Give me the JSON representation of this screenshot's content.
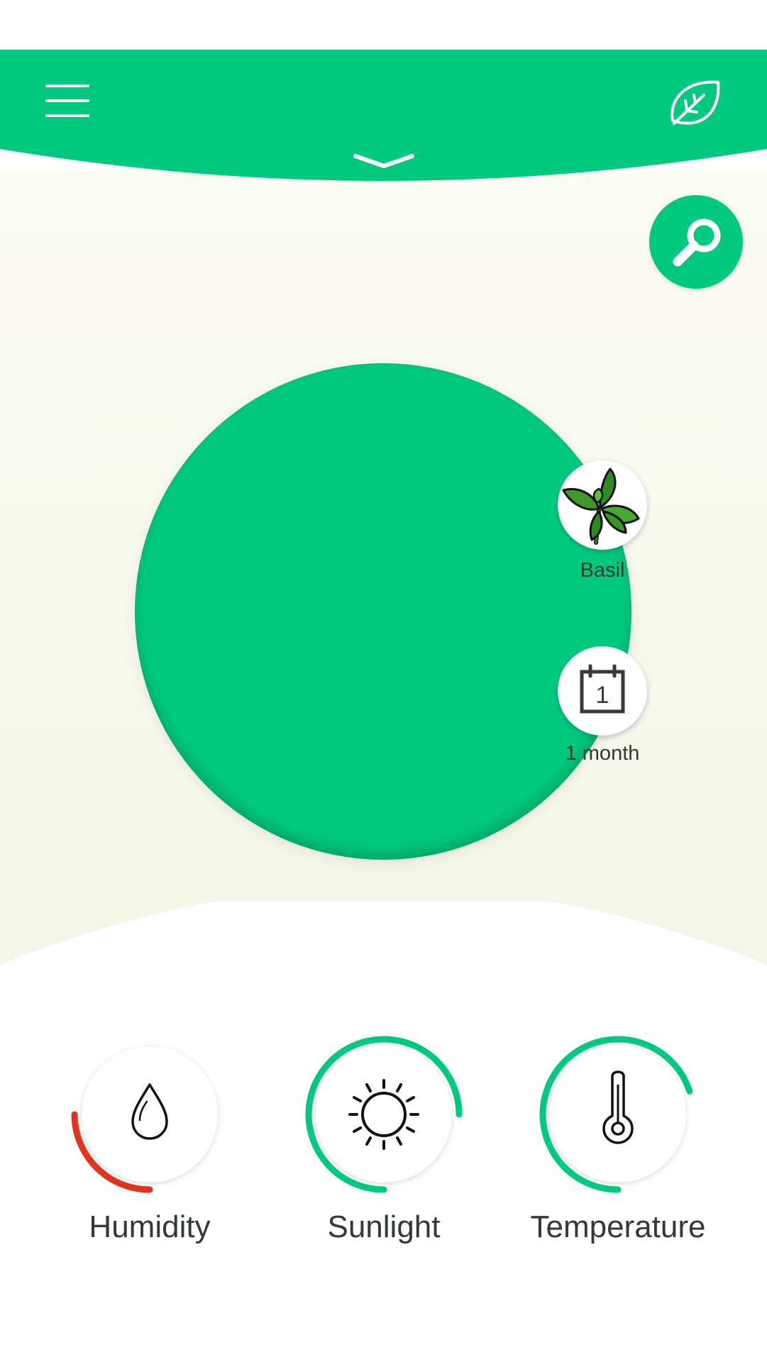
{
  "colors": {
    "brand_green": "#00c97f",
    "warning_red": "#e0341e",
    "text_dark": "#333a36"
  },
  "header": {
    "menu_icon": "hamburger-menu-icon",
    "logo_icon": "leaf-icon",
    "toggle_icon": "chevron-down-icon"
  },
  "search": {
    "icon": "magnifier-icon"
  },
  "plant": {
    "name": "Basil",
    "icon": "basil-leaves-icon"
  },
  "duration": {
    "value": "1 month",
    "calendar_day": "1",
    "icon": "calendar-icon"
  },
  "gauges": [
    {
      "label": "Humidity",
      "icon": "water-drop-icon",
      "level": 0.25,
      "color": "#e0341e"
    },
    {
      "label": "Sunlight",
      "icon": "sun-icon",
      "level": 0.75,
      "color": "#00c97f"
    },
    {
      "label": "Temperature",
      "icon": "thermometer-icon",
      "level": 0.7,
      "color": "#00c97f"
    }
  ]
}
